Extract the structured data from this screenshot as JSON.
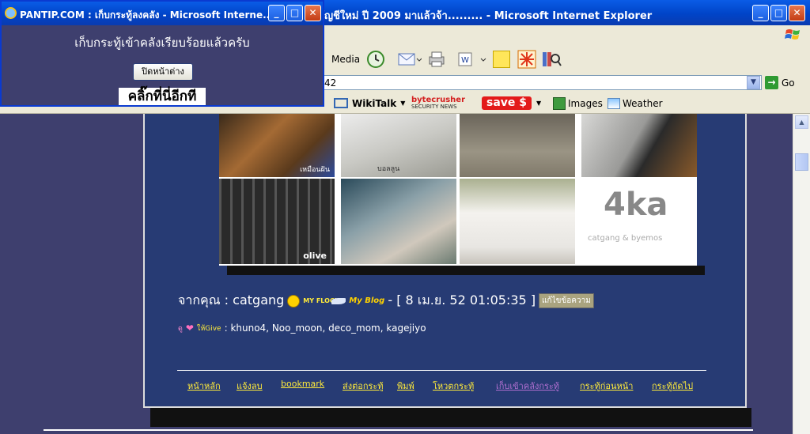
{
  "main_window": {
    "title": "ัญชีใหม่ ปี 2009 มาแล้วจ้า......... - Microsoft Internet Explorer",
    "controls": {
      "minimize": "_",
      "maximize": "□",
      "close": "✕"
    }
  },
  "toolbar": {
    "media_label": "Media"
  },
  "address_bar": {
    "value": "42",
    "go_label": "Go"
  },
  "links_bar": {
    "wikitalk_label": "WikiTalk",
    "bytecrusher_label": "bytecrusher",
    "bytecrusher_sub": "SECURITY NEWS",
    "save_label": "save $",
    "images_label": "Images",
    "weather_label": "Weather"
  },
  "popup": {
    "title": "PANTIP.COM : เก็บกระทู้ลงคลัง - Microsoft Interne...",
    "message": "เก็บกระทู้เข้าคลังเรียบร้อยแล้วครับ",
    "close_button": "ปิดหน้าต่าง",
    "click_again": "คลิ๊กที่นี่อีกที"
  },
  "post": {
    "collage_caption_1": "เหมือนฝัน",
    "collage_caption_2": "บอลลูน",
    "collage_caption_3": "olive",
    "collage_logo": "4ka",
    "collage_logo_sub": "catgang & byemos",
    "from_prefix": "จากคุณ : catgang",
    "my_flock": "MY FLOCK",
    "my_blog": "My Blog",
    "timestamp": "- [ 8 เม.ย. 52 01:05:35 ]",
    "edit_button": "แก้ไขข้อความ",
    "give_prefix": "ดู",
    "give_label": "ให้Give",
    "givers": ": khuno4, Noo_moon, deco_mom, kagejiyo"
  },
  "footer_links": [
    "หน้าหลัก",
    "แจ้งลบ",
    "bookmark",
    "ส่งต่อกระทู้",
    "พิมพ์",
    "โหวตกระทู้",
    "เก็บเข้าคลังกระทู้",
    "กระทู้ก่อนหน้า",
    "กระทู้ถัดไป"
  ],
  "colors": {
    "page_bg": "#3e3f6e",
    "post_bg": "#273b74",
    "link_yellow": "#ffeb3b",
    "xp_blue": "#0a5ce6"
  }
}
